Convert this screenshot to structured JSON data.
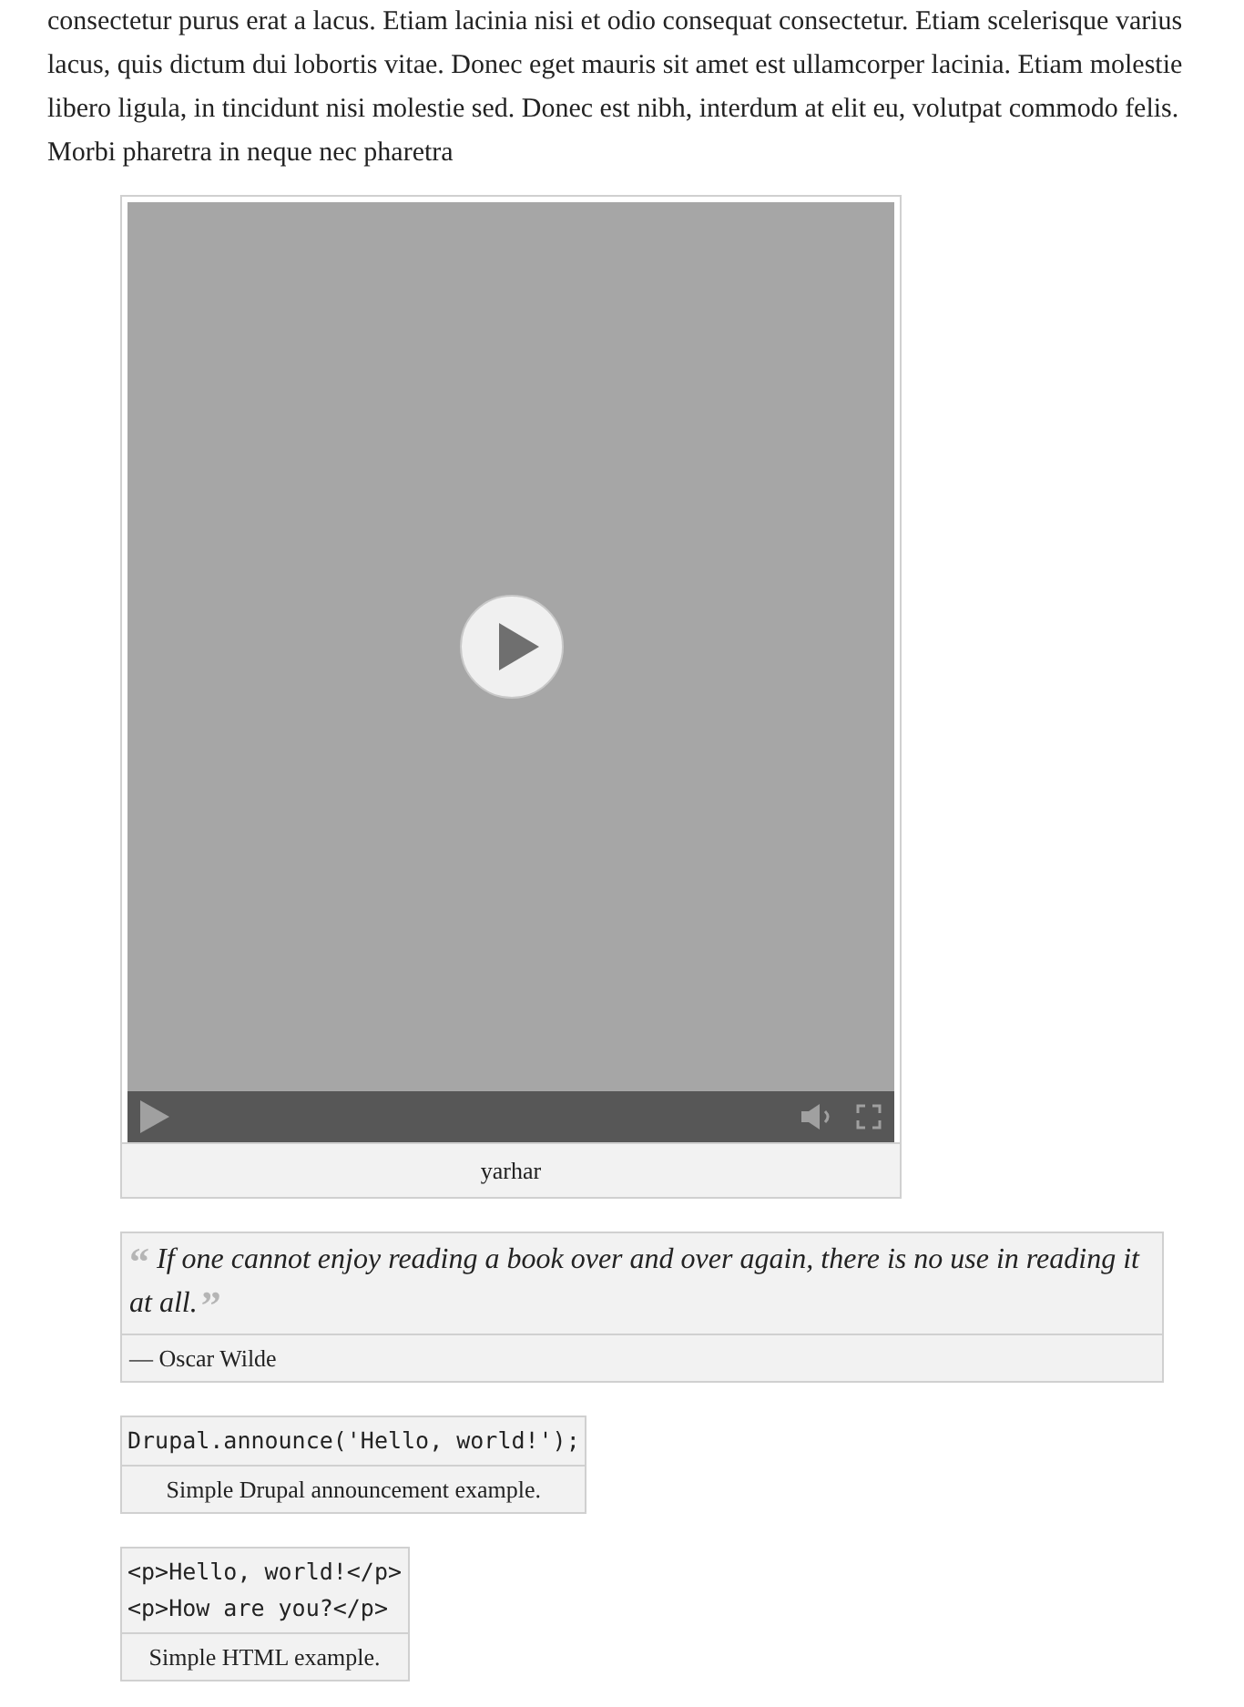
{
  "paragraph": "consectetur purus erat a lacus. Etiam lacinia nisi et odio consequat consectetur. Etiam scelerisque varius lacus, quis dictum dui lobortis vitae. Donec eget mauris sit amet est ullamcorper lacinia. Etiam molestie libero ligula, in tincidunt nisi molestie sed. Donec est nibh, interdum at elit eu, volutpat commodo felis. Morbi pharetra in neque nec pharetra",
  "video": {
    "caption": "yarhar"
  },
  "quote": {
    "open_mark": "“",
    "text": "If one cannot enjoy reading a book over and over again, there is no use in reading it at all.",
    "close_mark": "”",
    "attribution": "— Oscar Wilde"
  },
  "code_examples": [
    {
      "lines": [
        "Drupal.announce('Hello, world!');"
      ],
      "caption": "Simple Drupal announcement example."
    },
    {
      "lines": [
        "<p>Hello, world!</p>",
        "<p>How are you?</p>"
      ],
      "caption": "Simple HTML example."
    }
  ]
}
